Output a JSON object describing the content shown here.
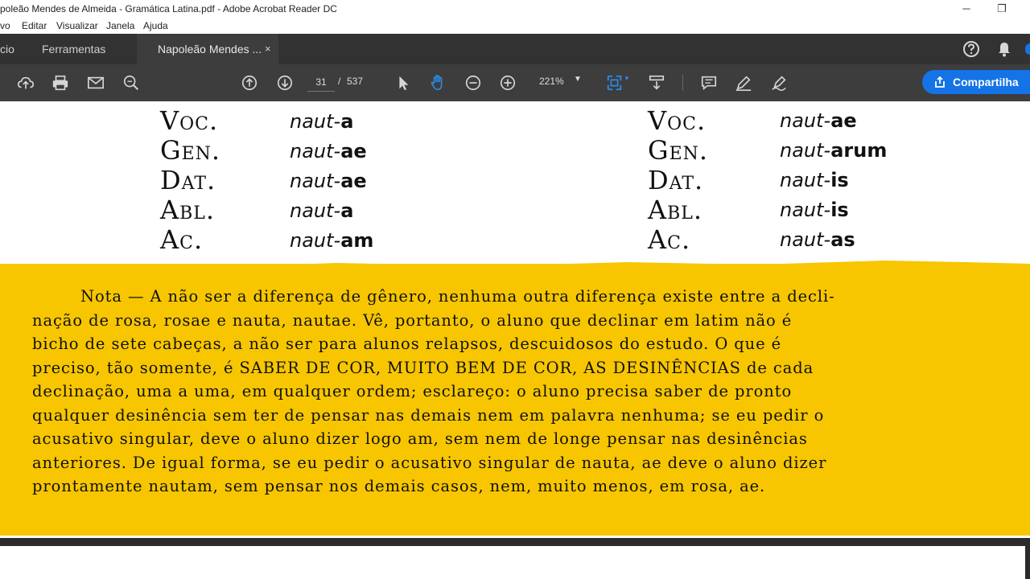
{
  "window": {
    "title": "poleão Mendes de Almeida - Gramática Latina.pdf - Adobe Acrobat Reader DC",
    "minimize": "─",
    "restore": "❐"
  },
  "menu": [
    "vo",
    "Editar",
    "Visualizar",
    "Janela",
    "Ajuda"
  ],
  "tabs": {
    "home": "cio",
    "tools": "Ferramentas",
    "document": "Napoleão Mendes ...",
    "close": "×"
  },
  "toolbar": {
    "current_page": "31",
    "page_separator": "/",
    "total_pages": "537",
    "zoom": "221%",
    "share_label": "Compartilha"
  },
  "declension": {
    "left": [
      {
        "case": "Voc.",
        "stem": "naut-",
        "ending": "a"
      },
      {
        "case": "Gen.",
        "stem": "naut-",
        "ending": "ae"
      },
      {
        "case": "Dat.",
        "stem": "naut-",
        "ending": "ae"
      },
      {
        "case": "Abl.",
        "stem": "naut-",
        "ending": "a"
      },
      {
        "case": "Ac.",
        "stem": "naut-",
        "ending": "am"
      }
    ],
    "right": [
      {
        "case": "Voc.",
        "stem": "naut-",
        "ending": "ae"
      },
      {
        "case": "Gen.",
        "stem": "naut-",
        "ending": "arum"
      },
      {
        "case": "Dat.",
        "stem": "naut-",
        "ending": "is"
      },
      {
        "case": "Abl.",
        "stem": "naut-",
        "ending": "is"
      },
      {
        "case": "Ac.",
        "stem": "naut-",
        "ending": "as"
      }
    ]
  },
  "note": {
    "lines": [
      "Nota — A não ser a diferença de gênero, nenhuma outra diferença existe entre a decli-",
      "nação de rosa, rosae e nauta, nautae. Vê, portanto, o aluno que declinar em latim não é",
      "bicho de sete cabeças, a não ser para alunos relapsos, descuidosos do estudo. O que é",
      "preciso, tão somente, é SABER DE COR, MUITO BEM DE COR, AS DESINÊNCIAS de cada",
      "declinação, uma a uma, em qualquer ordem; esclareço: o aluno precisa saber de pronto",
      "qualquer desinência sem ter de pensar nas demais nem em palavra nenhuma; se eu pedir o",
      "acusativo singular, deve o aluno dizer logo am, sem nem de longe pensar nas desinências",
      "anteriores. De igual forma, se eu pedir o acusativo singular de nauta, ae deve o aluno dizer",
      "prontamente nautam, sem pensar nos demais casos, nem, muito menos, em rosa, ae."
    ]
  },
  "colors": {
    "tabbar": "#323232",
    "toolbar": "#3d3d3d",
    "accent": "#1473e6",
    "highlight": "#f7c600"
  }
}
